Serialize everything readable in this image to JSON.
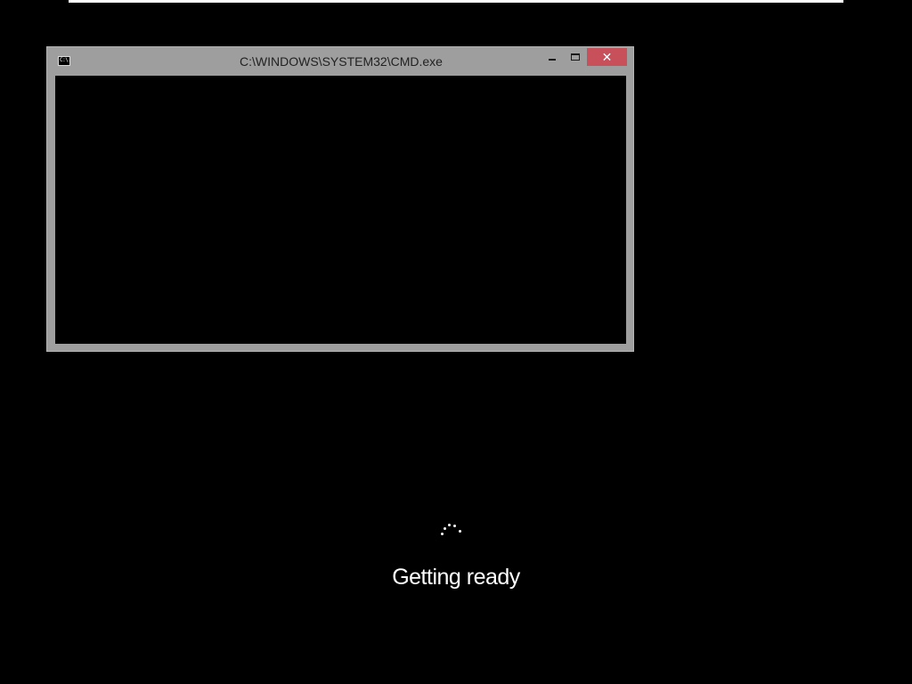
{
  "window": {
    "title": "C:\\WINDOWS\\SYSTEM32\\CMD.exe",
    "icon": "cmd-icon",
    "icon_text": "C:\\.",
    "controls": {
      "minimize_icon": "minimize-icon",
      "maximize_icon": "maximize-icon",
      "close_icon": "close-icon",
      "close_glyph": "✕"
    },
    "console_text": ""
  },
  "boot": {
    "status": "Getting ready",
    "spinner_icon": "loading-spinner-icon"
  },
  "colors": {
    "background": "#000000",
    "window_frame": "#9e9e9e",
    "close_button": "#c7505a",
    "text": "#ffffff"
  }
}
